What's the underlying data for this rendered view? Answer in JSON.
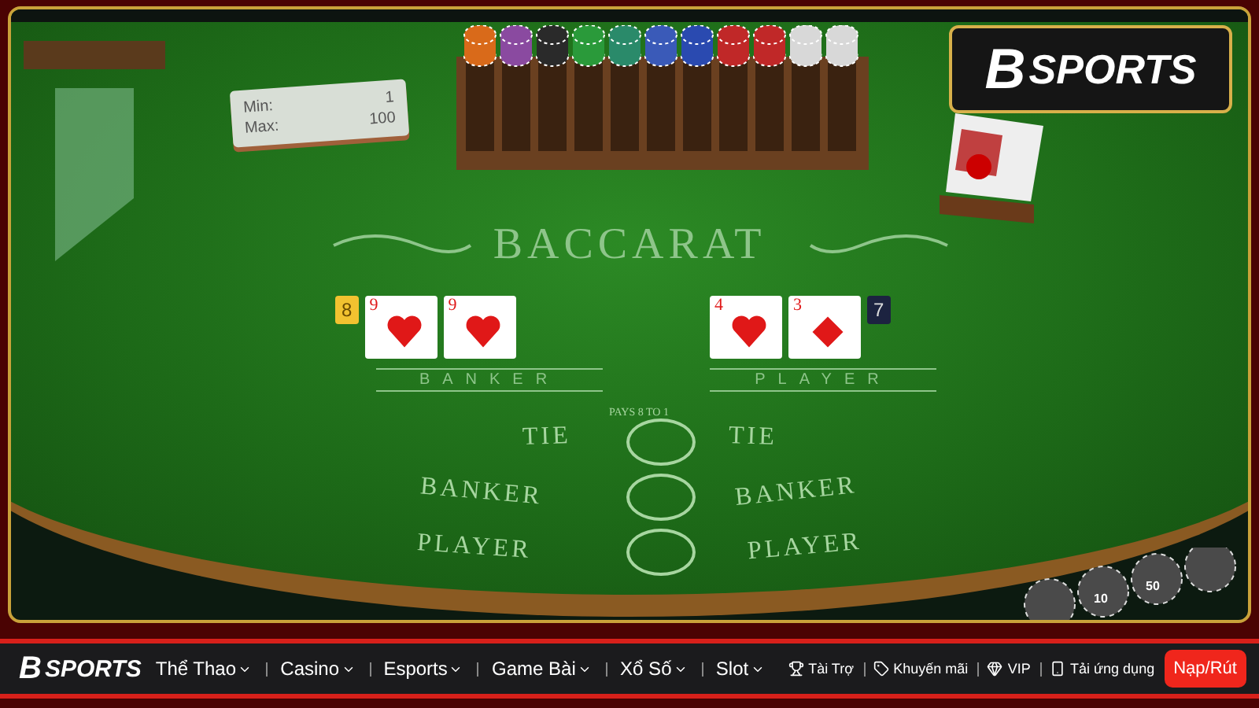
{
  "game": {
    "title": "BACCARAT",
    "limits": [
      {
        "label": "Min:",
        "value": "1"
      },
      {
        "label": "Max:",
        "value": "100"
      }
    ],
    "hands": [
      {
        "kind": "banker",
        "label": "BANKER",
        "score": "8",
        "color": "#f2c230",
        "cards": [
          {
            "rank": "9",
            "kind": "hearts"
          },
          {
            "rank": "9",
            "kind": "hearts"
          }
        ]
      },
      {
        "kind": "player",
        "label": "PLAYER",
        "score": "7",
        "color": "#1c2340",
        "cards": [
          {
            "rank": "4",
            "kind": "hearts"
          },
          {
            "rank": "3",
            "kind": "diamonds"
          }
        ]
      }
    ],
    "pays": "PAYS 8 TO 1",
    "bets": [
      {
        "left": "TIE",
        "right": "TIE"
      },
      {
        "left": "BANKER",
        "right": "BANKER"
      },
      {
        "left": "PLAYER",
        "right": "PLAYER"
      }
    ],
    "chip_labels": [
      "10",
      "50"
    ]
  },
  "overlay_logo": {
    "mark": "B",
    "text": "SPORTS"
  },
  "navbar": {
    "logo": {
      "mark": "B",
      "text": "SPORTS"
    },
    "menu": [
      {
        "label": "Thể Thao"
      },
      {
        "label": "Casino"
      },
      {
        "label": "Esports"
      },
      {
        "label": "Game Bài"
      },
      {
        "label": "Xổ Số"
      },
      {
        "label": "Slot"
      }
    ],
    "links": [
      {
        "kind": "trophy",
        "label": "Tài Trợ"
      },
      {
        "kind": "tag",
        "label": "Khuyến mãi"
      },
      {
        "kind": "diamond",
        "label": "VIP"
      },
      {
        "kind": "phone",
        "label": "Tải ứng dụng"
      }
    ],
    "cta": "Nạp/Rút"
  }
}
